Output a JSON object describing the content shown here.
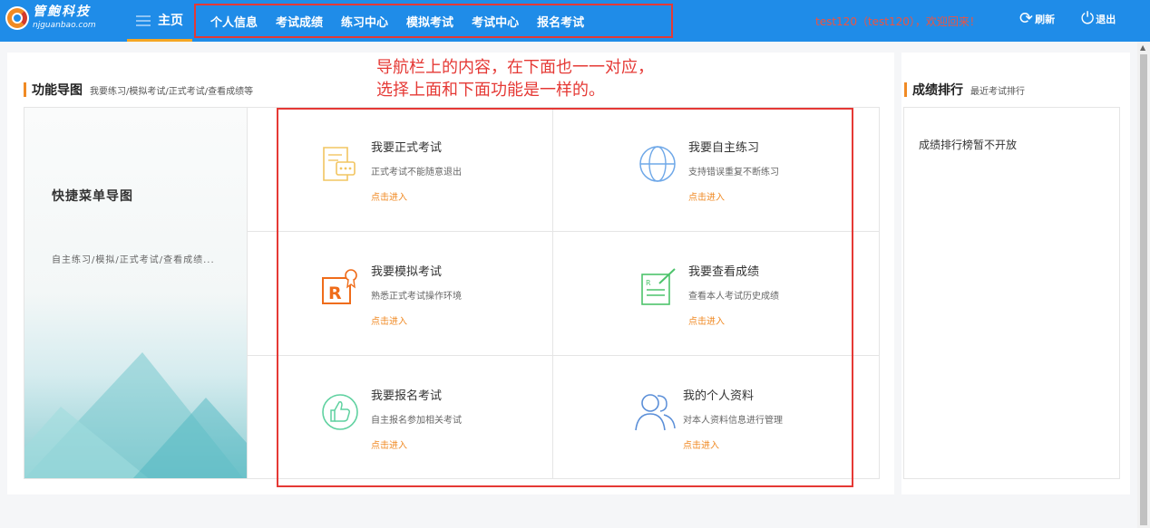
{
  "header": {
    "brand_name": "管鲍科技",
    "brand_url": "njguanbao.com",
    "home_label": "主页",
    "nav_items": [
      "个人信息",
      "考试成绩",
      "练习中心",
      "模拟考试",
      "考试中心",
      "报名考试"
    ],
    "welcome": "test120（test120），欢迎回来！",
    "refresh_label": "刷新",
    "logout_label": "退出"
  },
  "annotation": {
    "line1": "导航栏上的内容，在下面也一一对应，",
    "line2": "选择上面和下面功能是一样的。"
  },
  "left_section": {
    "title": "功能导图",
    "subtitle": "我要练习/模拟考试/正式考试/查看成绩等"
  },
  "quick_menu": {
    "title": "快捷菜单导图",
    "subtitle": "自主练习/模拟/正式考试/查看成绩..."
  },
  "functions": [
    {
      "title": "我要正式考试",
      "desc": "正式考试不能随意退出",
      "link": "点击进入",
      "icon": "document-chat-icon"
    },
    {
      "title": "我要自主练习",
      "desc": "支持错误重复不断练习",
      "link": "点击进入",
      "icon": "globe-icon"
    },
    {
      "title": "我要模拟考试",
      "desc": "熟悉正式考试操作环境",
      "link": "点击进入",
      "icon": "certificate-icon"
    },
    {
      "title": "我要查看成绩",
      "desc": "查看本人考试历史成绩",
      "link": "点击进入",
      "icon": "report-edit-icon"
    },
    {
      "title": "我要报名考试",
      "desc": "自主报名参加相关考试",
      "link": "点击进入",
      "icon": "thumbs-up-icon"
    },
    {
      "title": "我的个人资料",
      "desc": "对本人资料信息进行管理",
      "link": "点击进入",
      "icon": "users-icon"
    }
  ],
  "right_section": {
    "title": "成绩排行",
    "subtitle": "最近考试排行",
    "empty_text": "成绩排行榜暂不开放"
  },
  "colors": {
    "nav_bg": "#1f8ce8",
    "accent": "#f08a24",
    "annotation": "#e53935",
    "welcome": "#f0533f"
  }
}
